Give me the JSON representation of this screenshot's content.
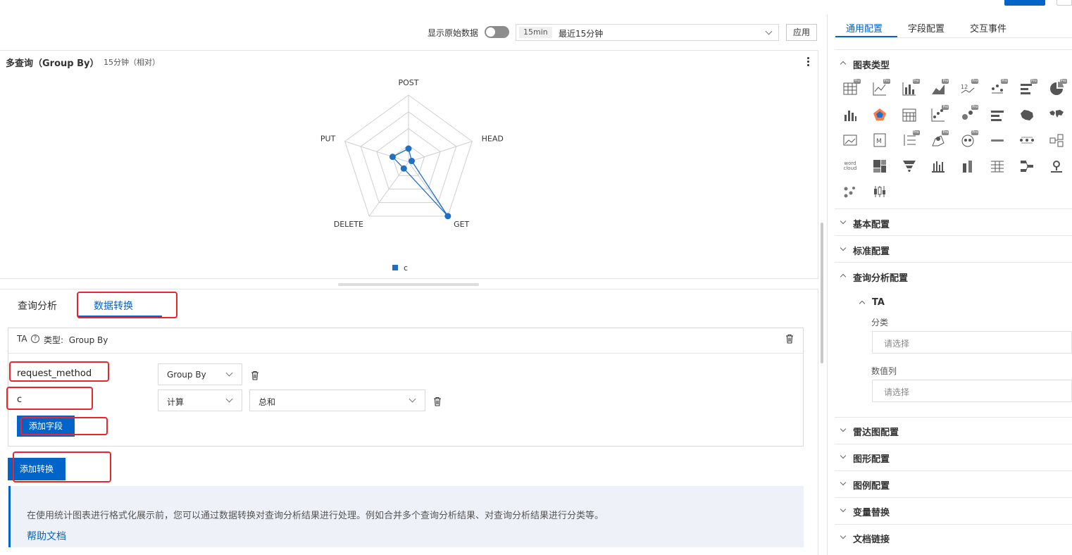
{
  "toolbar": {
    "raw_data_label": "显示原始数据",
    "time_tag": "15min",
    "time_text": "最近15分钟",
    "apply_label": "应用"
  },
  "chart_panel": {
    "title": "多查询（Group By）",
    "subtitle": "15分钟（相对）"
  },
  "chart_data": {
    "type": "radar",
    "indicators": [
      "POST",
      "HEAD",
      "GET",
      "DELETE",
      "PUT"
    ],
    "series": [
      {
        "name": "c",
        "values": [
          0.2,
          0.05,
          1.0,
          0.12,
          0.25
        ]
      }
    ],
    "range": [
      0,
      1
    ],
    "levels": 4,
    "legend": "bottom-center",
    "colors": {
      "series": "#1f6fc5",
      "grid": "#cfcfcf"
    }
  },
  "lower_tabs": [
    {
      "label": "查询分析",
      "active": false
    },
    {
      "label": "数据转换",
      "active": true
    }
  ],
  "transform": {
    "name": "TA",
    "type_label": "类型:",
    "type_value": "Group By",
    "rows": [
      {
        "field": "request_method",
        "op": "Group By"
      },
      {
        "field": "c",
        "op": "计算",
        "agg": "总和"
      }
    ],
    "add_field_label": "添加字段",
    "add_transform_label": "添加转换"
  },
  "info": {
    "text": "在使用统计图表进行格式化展示前，您可以通过数据转换对查询分析结果进行处理。例如合并多个查询分析结果、对查询分析结果进行分类等。",
    "link": "帮助文档"
  },
  "right_panel": {
    "tabs": [
      {
        "label": "通用配置",
        "active": true
      },
      {
        "label": "字段配置",
        "active": false
      },
      {
        "label": "交互事件",
        "active": false
      }
    ],
    "chart_type_label": "图表类型",
    "chart_type_icons": [
      "table-icon",
      "line-chart-icon",
      "bar-chart-icon",
      "area-chart-icon",
      "single-value-icon",
      "flow-chart-icon",
      "horizontal-bar-icon",
      "pie-chart-icon",
      "histogram-icon",
      "radar-chart-icon",
      "calendar-icon",
      "scatter-icon",
      "bubble-icon",
      "progress-bar-icon",
      "china-map-icon",
      "world-map-icon",
      "image-icon",
      "markdown-icon",
      "list-icon",
      "geo-icon",
      "amap-icon",
      "divider-icon",
      "topology-icon",
      "relation-icon",
      "word-cloud-icon",
      "treemap-icon",
      "funnel-icon",
      "column-icon",
      "stacked-bar-icon",
      "grid-table-icon",
      "sankey-icon",
      "pin-map-icon",
      "dots-icon",
      "candle-icon"
    ],
    "word_cloud_text": "word cloud",
    "pro_badge": "Pro",
    "sections": [
      {
        "label": "基本配置",
        "open": false
      },
      {
        "label": "标准配置",
        "open": false
      },
      {
        "label": "查询分析配置",
        "open": true
      }
    ],
    "ta": {
      "label": "TA",
      "category_label": "分类",
      "category_placeholder": "请选择",
      "value_label": "数值列",
      "value_placeholder": "请选择"
    },
    "sections_bottom": [
      {
        "label": "雷达图配置"
      },
      {
        "label": "图形配置"
      },
      {
        "label": "图例配置"
      },
      {
        "label": "变量替换"
      },
      {
        "label": "文档链接"
      }
    ]
  }
}
